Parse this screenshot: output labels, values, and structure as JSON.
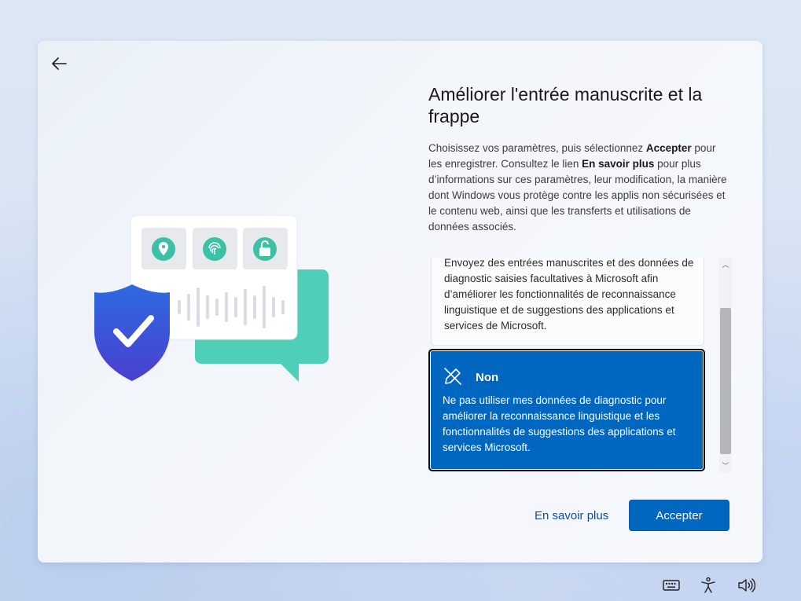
{
  "page": {
    "title": "Améliorer l'entrée manuscrite et la frappe",
    "description_parts": {
      "p1": "Choisissez vos paramètres, puis sélectionnez ",
      "b1": "Accepter",
      "p2": " pour les enregistrer. Consultez le lien ",
      "b2": "En savoir plus",
      "p3": " pour plus d’informations sur ces paramètres, leur modification, la manière dont Windows vous protège contre les applis non sécurisées et le contenu web, ainsi que les transferts et utilisations de données associés."
    }
  },
  "options": {
    "yes_text": "Envoyez des entrées manuscrites et des données de diagnostic saisies facultatives à Microsoft afin d’améliorer les fonctionnalités de reconnaissance linguistique et de suggestions des applications et services de Microsoft.",
    "no_title": "Non",
    "no_text": "Ne pas utiliser mes données de diagnostic pour améliorer la reconnaissance linguistique et les fonctionnalités de suggestions des applications et services Microsoft."
  },
  "actions": {
    "learn_more": "En savoir plus",
    "accept": "Accepter"
  },
  "scrollbar": {
    "up_glyph": "︿",
    "down_glyph": "﹀"
  },
  "icons": {
    "back": "back-arrow-icon",
    "no_option": "pen-crossed-icon",
    "tray": [
      "keyboard-icon",
      "accessibility-icon",
      "volume-icon"
    ]
  },
  "colors": {
    "accent": "#0067c0",
    "link": "#0f4c9c",
    "shield": "#2f5fd9",
    "chat": "#4dcdb6"
  }
}
